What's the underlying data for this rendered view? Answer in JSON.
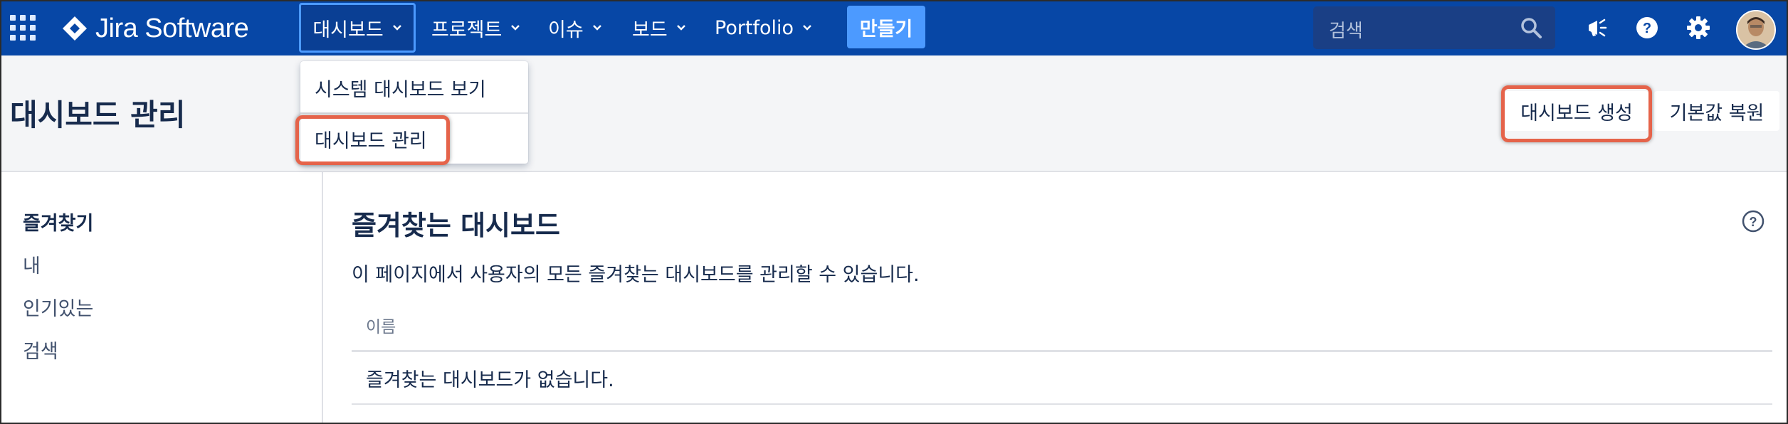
{
  "app": {
    "name": "Jira Software"
  },
  "nav": {
    "items": [
      {
        "label": "대시보드"
      },
      {
        "label": "프로젝트"
      },
      {
        "label": "이슈"
      },
      {
        "label": "보드"
      },
      {
        "label": "Portfolio"
      }
    ],
    "create_label": "만들기",
    "search_placeholder": "검색"
  },
  "dropdown": {
    "items": [
      {
        "label": "시스템 대시보드 보기"
      },
      {
        "label": "대시보드 관리"
      }
    ]
  },
  "header": {
    "title": "대시보드 관리",
    "create_button": "대시보드 생성",
    "restore_button": "기본값 복원"
  },
  "sidebar": {
    "items": [
      {
        "label": "즐겨찾기",
        "selected": true
      },
      {
        "label": "내"
      },
      {
        "label": "인기있는"
      },
      {
        "label": "검색"
      }
    ]
  },
  "main": {
    "title": "즐겨찾는 대시보드",
    "description": "이 페이지에서 사용자의 모든 즐겨찾는 대시보드를 관리할 수 있습니다.",
    "table": {
      "columns": [
        "이름"
      ],
      "empty_message": "즐겨찾는 대시보드가 없습니다."
    }
  },
  "icons": [
    "app-switcher-icon",
    "jira-logo-icon",
    "chevron-down-icon",
    "search-icon",
    "megaphone-icon",
    "help-icon",
    "settings-icon",
    "avatar"
  ],
  "colors": {
    "nav_bg": "#0747a6",
    "accent": "#4c9aff",
    "highlight": "#e5634a",
    "header_bg": "#f4f5f7"
  }
}
